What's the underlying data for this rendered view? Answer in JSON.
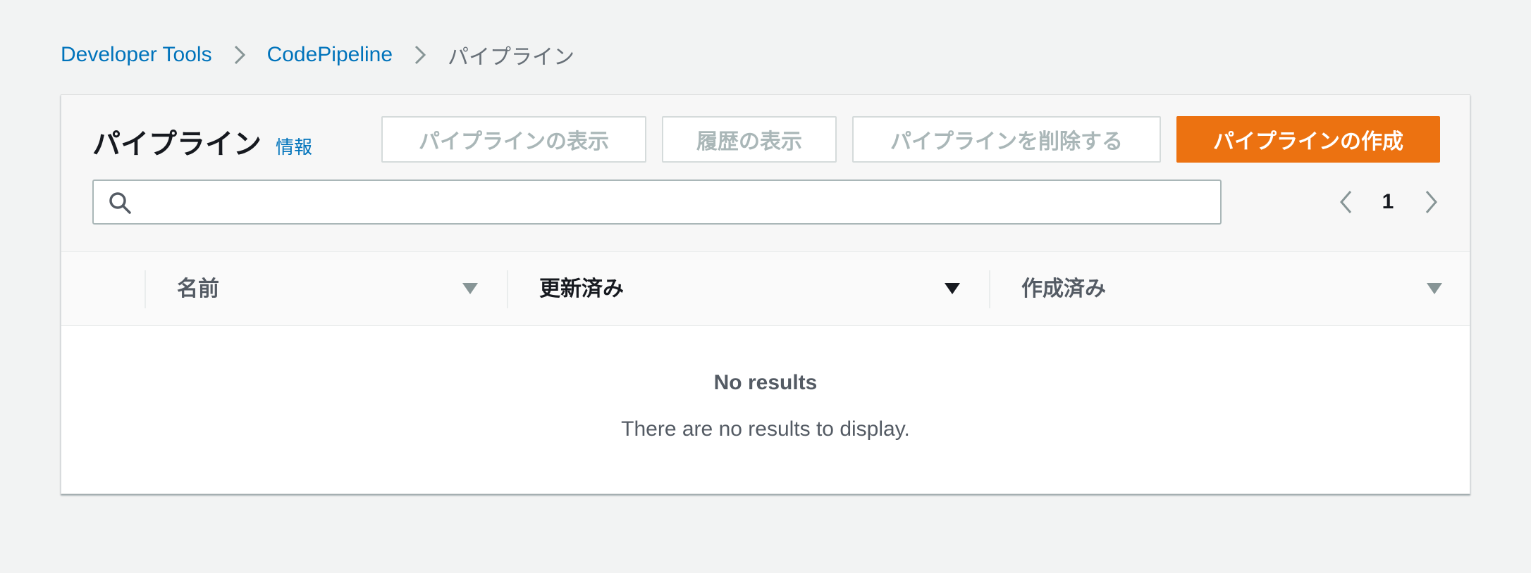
{
  "breadcrumb": {
    "items": [
      "Developer Tools",
      "CodePipeline"
    ],
    "current": "パイプライン"
  },
  "panel": {
    "title": "パイプライン",
    "info_label": "情報",
    "buttons": {
      "view": "パイプラインの表示",
      "history": "履歴の表示",
      "delete": "パイプラインを削除する",
      "create": "パイプラインの作成"
    },
    "search": {
      "value": "",
      "placeholder": ""
    },
    "pagination": {
      "current_page": "1"
    }
  },
  "table": {
    "columns": [
      "名前",
      "更新済み",
      "作成済み"
    ],
    "empty": {
      "title": "No results",
      "description": "There are no results to display."
    }
  },
  "colors": {
    "link": "#0073bb",
    "primary_button": "#ec7211",
    "background": "#f2f3f3"
  },
  "icons": [
    "chevron-right-icon",
    "search-icon",
    "chevron-left-icon",
    "sort-down-icon"
  ]
}
